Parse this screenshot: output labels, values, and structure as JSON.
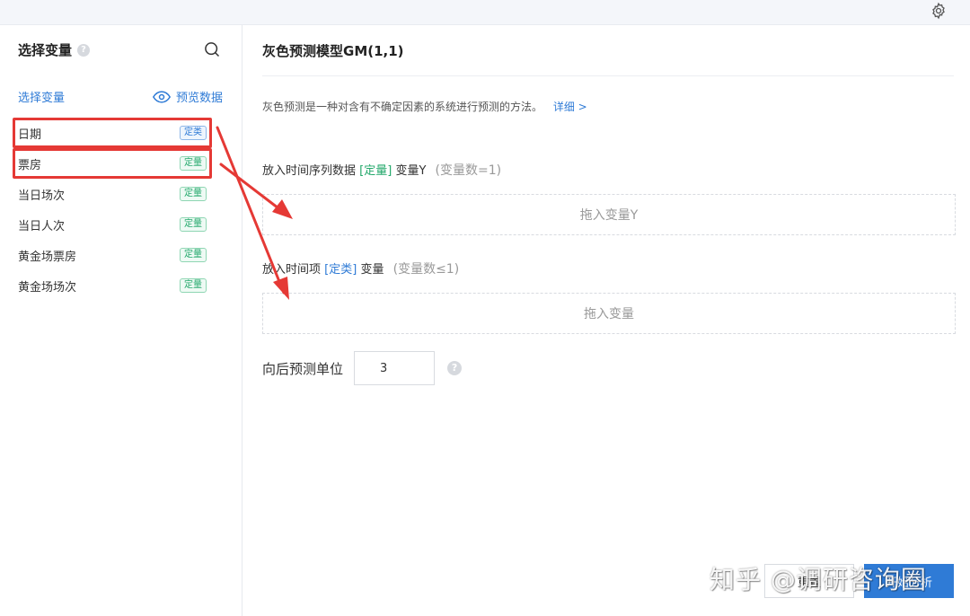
{
  "left_panel": {
    "title": "选择变量",
    "help": "?",
    "sub_label": "选择变量",
    "preview_label": "预览数据",
    "variables": [
      {
        "name": "日期",
        "tag": "定类",
        "tag_type": "cat",
        "highlighted": true
      },
      {
        "name": "票房",
        "tag": "定量",
        "tag_type": "num",
        "highlighted": true
      },
      {
        "name": "当日场次",
        "tag": "定量",
        "tag_type": "num",
        "highlighted": false
      },
      {
        "name": "当日人次",
        "tag": "定量",
        "tag_type": "num",
        "highlighted": false
      },
      {
        "name": "黄金场票房",
        "tag": "定量",
        "tag_type": "num",
        "highlighted": false
      },
      {
        "name": "黄金场场次",
        "tag": "定量",
        "tag_type": "num",
        "highlighted": false
      }
    ]
  },
  "main": {
    "title": "灰色预测模型GM(1,1)",
    "description": "灰色预测是一种对含有不确定因素的系统进行预测的方法。",
    "detail_link": "详细 >",
    "section_y": {
      "prefix": "放入时间序列数据",
      "tag": "[定量]",
      "suffix": "变量Y",
      "count": "(变量数=1)",
      "drop_placeholder": "拖入变量Y"
    },
    "section_time": {
      "prefix": "放入时间项",
      "tag": "[定类]",
      "suffix": "变量",
      "count": "(变量数≤1)",
      "drop_placeholder": "拖入变量"
    },
    "forecast": {
      "label": "向后预测单位",
      "value": "3",
      "help": "?"
    },
    "reset_label": "重置",
    "run_label": "开始分析"
  },
  "watermark": "知乎 @调研咨询圈",
  "colors": {
    "accent": "#2f7bd6",
    "quant_tag": "#23a86b",
    "highlight": "#e53935"
  }
}
